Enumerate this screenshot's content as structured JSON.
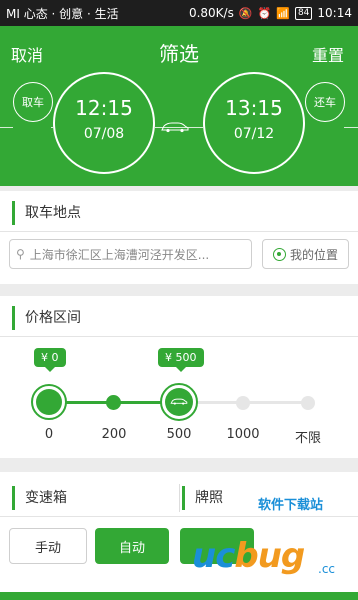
{
  "status_bar": {
    "left": "MI 心态 · 创意 · 生活",
    "speed": "0.80K/s",
    "battery": "84",
    "time": "10:14"
  },
  "header": {
    "title": "筛选",
    "cancel_label": "取消",
    "reset_label": "重置",
    "pickup_label": "取车",
    "return_label": "还车",
    "pickup_time": "12:15",
    "pickup_date": "07/08",
    "return_time": "13:15",
    "return_date": "07/12"
  },
  "location": {
    "title": "取车地点",
    "search_value": "上海市徐汇区上海漕河泾开发区...",
    "my_location_label": "我的位置"
  },
  "price": {
    "title": "价格区间",
    "ticks": [
      "0",
      "200",
      "500",
      "1000",
      "不限"
    ],
    "min_label": "¥ 0",
    "max_label": "¥ 500",
    "min_value": 0,
    "max_value": 500
  },
  "gearbox": {
    "title": "变速箱",
    "manual_label": "手动",
    "auto_label": "自动",
    "selected": "自动"
  },
  "plate": {
    "title": "牌照"
  },
  "watermark": {
    "brand": "软件下载站",
    "logo_u": "uc",
    "logo_o": "bug",
    "cc": ".cc"
  },
  "colors": {
    "accent": "#33a835",
    "background": "#ececec"
  }
}
